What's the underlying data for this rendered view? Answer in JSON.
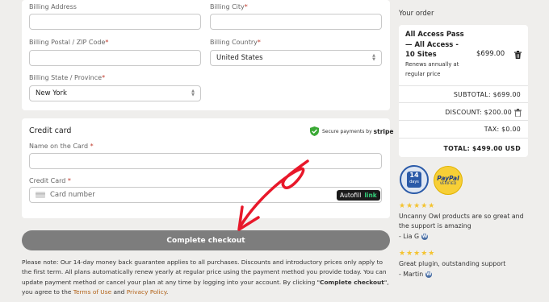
{
  "billing": {
    "address_label": "Billing Address",
    "city_label": "Billing City",
    "postal_label": "Billing Postal / ZIP Code",
    "country_label": "Billing Country",
    "country_value": "United States",
    "state_label": "Billing State / Province",
    "state_value": "New York",
    "required_mark": "*"
  },
  "credit_card": {
    "title": "Credit card",
    "secure_text": "Secure payments by",
    "stripe": "stripe",
    "name_label": "Name on the Card",
    "card_label": "Credit Card",
    "card_placeholder": "Card number",
    "autofill": "Autofill",
    "link": "link"
  },
  "checkout_button": "Complete checkout",
  "note": {
    "text1": "Please note: Our 14-day money back guarantee applies to all purchases. Discounts and introductory prices only apply to the first term. All plans automatically renew yearly at regular price using the payment method you provide today. You can update payment method or cancel your plan at any time by logging into your account. By clicking \"",
    "strong": "Complete checkout",
    "text2": "\", you agree to the ",
    "terms": "Terms of Use",
    "and": " and ",
    "privacy": "Privacy Policy",
    "end": "."
  },
  "order": {
    "title": "Your order",
    "item_name": "All Access Pass — All Access - 10 Sites",
    "item_sub": "Renews annually at regular price",
    "item_price": "$699.00",
    "subtotal": "SUBTOTAL: $699.00",
    "discount": "DISCOUNT:  $200.00",
    "tax": "TAX: $0.00",
    "total": "TOTAL: $499.00 USD"
  },
  "badges": {
    "guarantee_days": "14",
    "guarantee_unit": "days",
    "paypal": "PayPal",
    "verified": "VERIFIED"
  },
  "reviews": [
    {
      "stars": "★★★★★",
      "text": "Uncanny Owl products are so great and the support is amazing",
      "author": "- Lia G"
    },
    {
      "stars": "★★★★★",
      "text": "Great plugin, outstanding support",
      "author": "- Martin"
    }
  ],
  "colors": {
    "accent_link": "#b3641a",
    "button_gray": "#7d7d7d",
    "star": "#f4c330",
    "arrow": "#e8182a"
  },
  "icons": [
    "shield-check-icon",
    "card-icon",
    "trash-icon",
    "chevron-updown-icon",
    "wordpress-icon"
  ]
}
